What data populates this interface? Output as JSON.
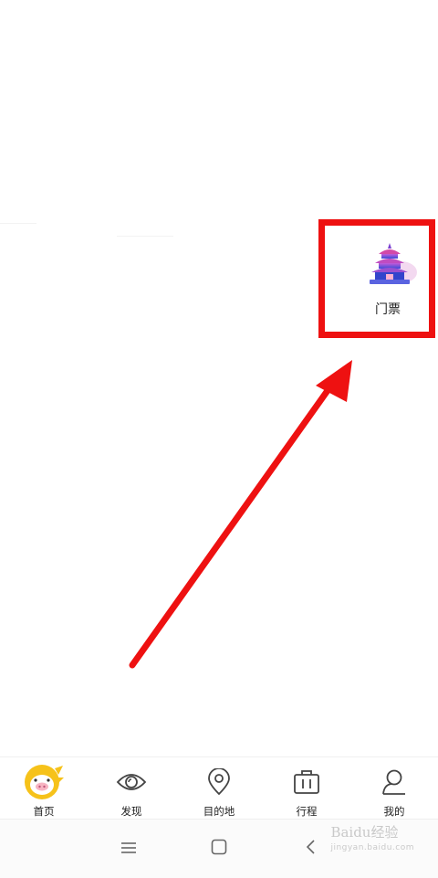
{
  "shortcut": {
    "label": "门票",
    "icon": "temple-of-heaven-icon"
  },
  "highlight_color": "#ee1111",
  "tabbar": {
    "tabs": [
      {
        "label": "首页",
        "icon": "pig-logo-icon",
        "active": true
      },
      {
        "label": "发现",
        "icon": "eye-icon"
      },
      {
        "label": "目的地",
        "icon": "location-pin-icon"
      },
      {
        "label": "行程",
        "icon": "suitcase-icon"
      },
      {
        "label": "我的",
        "icon": "user-icon"
      }
    ]
  },
  "system_nav": {
    "buttons": [
      "menu-icon",
      "home-square-icon",
      "back-chevron-icon"
    ]
  },
  "watermark": {
    "text": "Baidu经验",
    "sub": "jingyan.baidu.com"
  }
}
